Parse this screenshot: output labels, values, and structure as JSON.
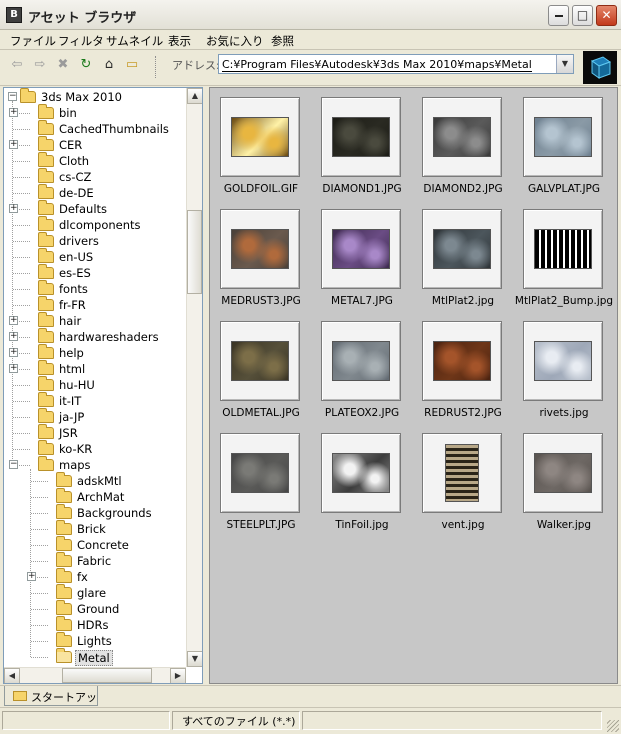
{
  "window": {
    "title": "アセット ブラウザ",
    "app_icon_letter": "B",
    "controls": {
      "minimize": "0",
      "maximize": "□",
      "close": "✕"
    }
  },
  "menu": [
    "ファイル",
    "フィルタ",
    "サムネイル",
    "表示",
    "お気に入り",
    "参照"
  ],
  "toolbar": {
    "back_glyph": "⇦",
    "forward_glyph": "⇨",
    "stop_glyph": "✖",
    "refresh_glyph": "↻",
    "home_glyph": "⌂",
    "folder_glyph": "▭",
    "address_label": "アドレス:",
    "address_value": "C:¥Program Files¥Autodesk¥3ds Max 2010¥maps¥Metal",
    "dropdown_glyph": "▼"
  },
  "tree": {
    "items": [
      {
        "label": "3ds Max 2010",
        "level": 0,
        "expander": "−"
      },
      {
        "label": "bin",
        "level": 1,
        "expander": "+"
      },
      {
        "label": "CachedThumbnails",
        "level": 1,
        "expander": ""
      },
      {
        "label": "CER",
        "level": 1,
        "expander": "+"
      },
      {
        "label": "Cloth",
        "level": 1,
        "expander": ""
      },
      {
        "label": "cs-CZ",
        "level": 1,
        "expander": ""
      },
      {
        "label": "de-DE",
        "level": 1,
        "expander": ""
      },
      {
        "label": "Defaults",
        "level": 1,
        "expander": "+"
      },
      {
        "label": "dlcomponents",
        "level": 1,
        "expander": ""
      },
      {
        "label": "drivers",
        "level": 1,
        "expander": ""
      },
      {
        "label": "en-US",
        "level": 1,
        "expander": ""
      },
      {
        "label": "es-ES",
        "level": 1,
        "expander": ""
      },
      {
        "label": "fonts",
        "level": 1,
        "expander": ""
      },
      {
        "label": "fr-FR",
        "level": 1,
        "expander": ""
      },
      {
        "label": "hair",
        "level": 1,
        "expander": "+"
      },
      {
        "label": "hardwareshaders",
        "level": 1,
        "expander": "+"
      },
      {
        "label": "help",
        "level": 1,
        "expander": "+"
      },
      {
        "label": "html",
        "level": 1,
        "expander": "+"
      },
      {
        "label": "hu-HU",
        "level": 1,
        "expander": ""
      },
      {
        "label": "it-IT",
        "level": 1,
        "expander": ""
      },
      {
        "label": "ja-JP",
        "level": 1,
        "expander": ""
      },
      {
        "label": "JSR",
        "level": 1,
        "expander": ""
      },
      {
        "label": "ko-KR",
        "level": 1,
        "expander": ""
      },
      {
        "label": "maps",
        "level": 1,
        "expander": "−"
      },
      {
        "label": "adskMtl",
        "level": 2,
        "expander": ""
      },
      {
        "label": "ArchMat",
        "level": 2,
        "expander": ""
      },
      {
        "label": "Backgrounds",
        "level": 2,
        "expander": ""
      },
      {
        "label": "Brick",
        "level": 2,
        "expander": ""
      },
      {
        "label": "Concrete",
        "level": 2,
        "expander": ""
      },
      {
        "label": "Fabric",
        "level": 2,
        "expander": ""
      },
      {
        "label": "fx",
        "level": 2,
        "expander": "+"
      },
      {
        "label": "glare",
        "level": 2,
        "expander": ""
      },
      {
        "label": "Ground",
        "level": 2,
        "expander": ""
      },
      {
        "label": "HDRs",
        "level": 2,
        "expander": ""
      },
      {
        "label": "Lights",
        "level": 2,
        "expander": ""
      },
      {
        "label": "Metal",
        "level": 2,
        "expander": "",
        "selected": true
      }
    ]
  },
  "thumbnails": [
    {
      "name": "GOLDFOIL.GIF",
      "colors": [
        "#6b4a10",
        "#e8b640",
        "#fff2a8"
      ]
    },
    {
      "name": "DIAMOND1.JPG",
      "colors": [
        "#1c1c16",
        "#4a4a3e",
        "#2a2a22"
      ]
    },
    {
      "name": "DIAMOND2.JPG",
      "colors": [
        "#3a3a3a",
        "#8c8c8c",
        "#5a5a5a"
      ]
    },
    {
      "name": "GALVPLAT.JPG",
      "colors": [
        "#6e8090",
        "#b4c4d0",
        "#8a9aa6"
      ]
    },
    {
      "name": "MEDRUST3.JPG",
      "colors": [
        "#4a4038",
        "#b06a3c",
        "#6a5a4e"
      ]
    },
    {
      "name": "METAL7.JPG",
      "colors": [
        "#3e2a50",
        "#a888c8",
        "#6a4c84"
      ]
    },
    {
      "name": "MtlPlat2.jpg",
      "colors": [
        "#2e3438",
        "#7c8890",
        "#4c565c"
      ]
    },
    {
      "name": "MtlPlat2_Bump.jpg",
      "colors": [
        "#000000",
        "#ffffff",
        "#555555"
      ]
    },
    {
      "name": "OLDMETAL.JPG",
      "colors": [
        "#3a3424",
        "#7c6e48",
        "#56503a"
      ]
    },
    {
      "name": "PLATEOX2.JPG",
      "colors": [
        "#626a72",
        "#a8b0b4",
        "#80888e"
      ]
    },
    {
      "name": "REDRUST2.JPG",
      "colors": [
        "#4a2210",
        "#a4542a",
        "#6e3618"
      ]
    },
    {
      "name": "rivets.jpg",
      "colors": [
        "#b8c0cc",
        "#e8ecf2",
        "#9ea8b8"
      ]
    },
    {
      "name": "STEELPLT.JPG",
      "colors": [
        "#464646",
        "#7a7a76",
        "#5a5a58"
      ]
    },
    {
      "name": "TinFoil.jpg",
      "colors": [
        "#8a8a8a",
        "#f2f2f2",
        "#3c3c3c"
      ]
    },
    {
      "name": "vent.jpg",
      "colors": [
        "#2a2418",
        "#b8a888",
        "#5a4e38"
      ]
    },
    {
      "name": "Walker.jpg",
      "colors": [
        "#5a5450",
        "#8e8682",
        "#6e6864"
      ]
    }
  ],
  "bottom": {
    "tab_label": "スタートアップ",
    "status_filter": "すべてのファイル (*.*)"
  }
}
